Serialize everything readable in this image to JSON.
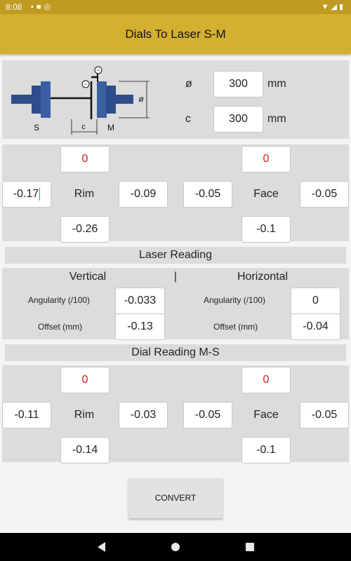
{
  "status_bar": {
    "time": "8:08"
  },
  "app_bar": {
    "title": "Dials To Laser S-M"
  },
  "diagram": {
    "label_s": "S",
    "label_m": "M",
    "label_c": "c",
    "label_phi": "ø",
    "minus_sign": "−"
  },
  "dimensions": {
    "phi_label": "ø",
    "phi_value": "300",
    "phi_unit": "mm",
    "c_label": "c",
    "c_value": "300",
    "c_unit": "mm"
  },
  "input_dials": {
    "rim": {
      "label": "Rim",
      "top": "0",
      "left": "-0.17",
      "right": "-0.09",
      "bottom": "-0.26"
    },
    "face": {
      "label": "Face",
      "top": "0",
      "left": "-0.05",
      "right": "-0.05",
      "bottom": "-0.1"
    }
  },
  "laser_reading": {
    "header": "Laser Reading",
    "vertical_label": "Vertical",
    "separator": "|",
    "horizontal_label": "Horizontal",
    "vertical": {
      "angularity_label": "Angularity (/100)",
      "angularity": "-0.033",
      "offset_label": "Offset (mm)",
      "offset": "-0.13"
    },
    "horizontal": {
      "angularity_label": "Angularity (/100)",
      "angularity": "0",
      "offset_label": "Offset (mm)",
      "offset": "-0.04"
    }
  },
  "dial_reading_ms": {
    "header": "Dial Reading M-S",
    "rim": {
      "label": "Rim",
      "top": "0",
      "left": "-0.11",
      "right": "-0.03",
      "bottom": "-0.14"
    },
    "face": {
      "label": "Face",
      "top": "0",
      "left": "-0.05",
      "right": "-0.05",
      "bottom": "-0.1"
    }
  },
  "convert_button": {
    "label": "CONVERT"
  }
}
